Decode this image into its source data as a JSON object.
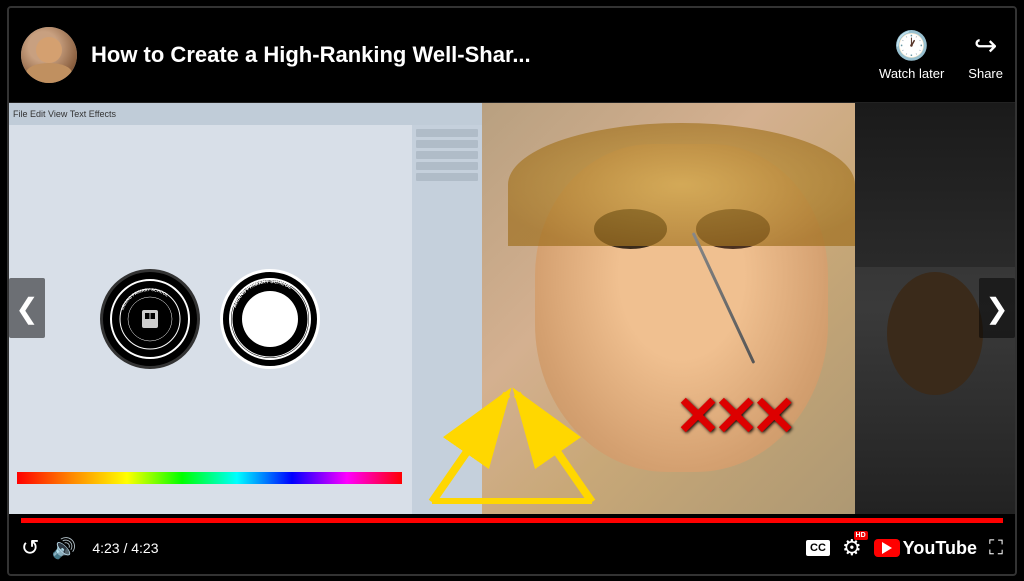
{
  "player": {
    "title": "How to Create a High-Ranking Well-Shar...",
    "watch_later_label": "Watch later",
    "share_label": "Share",
    "time_current": "4:23",
    "time_total": "4:23",
    "time_display": "4:23 / 4:23",
    "progress_percent": 100,
    "nav_left": "❮",
    "nav_right": "❯",
    "cc_label": "CC",
    "hd_label": "HD",
    "youtube_label": "YouTube",
    "icons": {
      "watch_later": "🕐",
      "share": "↪",
      "replay": "↺",
      "volume": "🔊",
      "fullscreen": "⛶",
      "gear": "⚙"
    }
  }
}
